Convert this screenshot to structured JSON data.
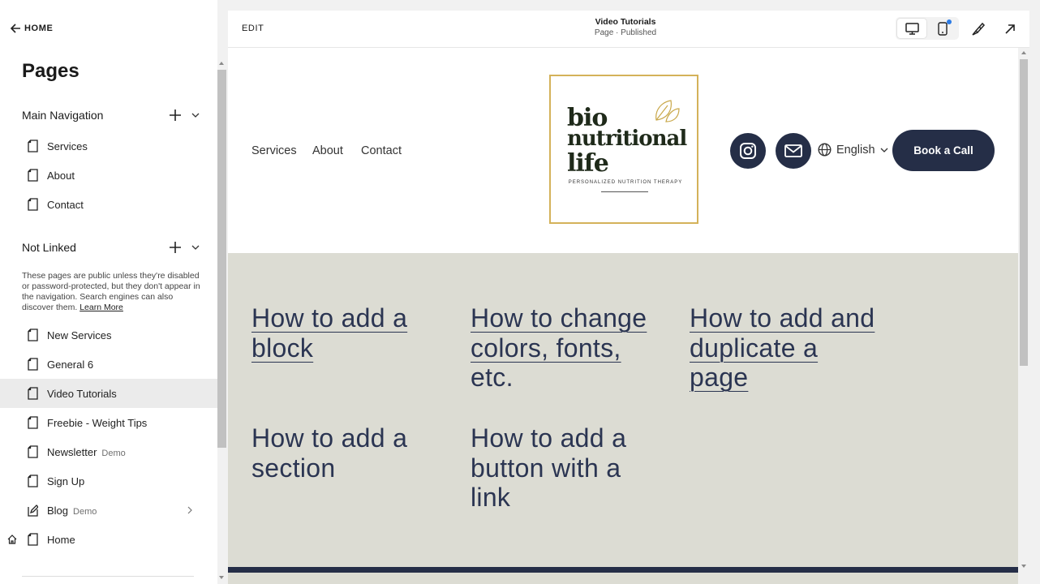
{
  "sidebar": {
    "back_label": "HOME",
    "title": "Pages",
    "main_navigation": {
      "label": "Main Navigation",
      "items": [
        {
          "label": "Services"
        },
        {
          "label": "About"
        },
        {
          "label": "Contact"
        }
      ]
    },
    "not_linked": {
      "label": "Not Linked",
      "note": "These pages are public unless they're disabled or password-protected, but they don't appear in the navigation. Search engines can also discover them.",
      "learn_more": "Learn More",
      "items": [
        {
          "label": "New Services",
          "badge": ""
        },
        {
          "label": "General 6",
          "badge": ""
        },
        {
          "label": "Video Tutorials",
          "badge": "",
          "selected": true
        },
        {
          "label": "Freebie - Weight Tips",
          "badge": ""
        },
        {
          "label": "Newsletter",
          "badge": "Demo"
        },
        {
          "label": "Sign Up",
          "badge": ""
        },
        {
          "label": "Blog",
          "badge": "Demo"
        },
        {
          "label": "Home",
          "badge": ""
        }
      ]
    }
  },
  "editor": {
    "edit_label": "EDIT",
    "page_title": "Video Tutorials",
    "page_status": "Page · Published",
    "icons": [
      "desktop-icon",
      "mobile-icon",
      "brush-icon",
      "external-arrow-icon"
    ]
  },
  "site": {
    "nav": [
      "Services",
      "About",
      "Contact"
    ],
    "logo": {
      "line1": "bio",
      "line2": "nutritional",
      "line3": "life",
      "tagline": "PERSONALIZED NUTRITION THERAPY"
    },
    "language": "English",
    "cta": "Book a Call",
    "tutorials": [
      {
        "lines": [
          "How to add a",
          "block"
        ],
        "link": true
      },
      {
        "lines": [
          "How to change",
          "colors, fonts,",
          "etc."
        ],
        "link": true
      },
      {
        "lines": [
          "How to add and",
          "duplicate a",
          "page"
        ],
        "link": true
      },
      {
        "lines": [
          "How to add a",
          "section"
        ],
        "link": false
      },
      {
        "lines": [
          "How to add a",
          "button with a",
          "link"
        ],
        "link": false
      }
    ]
  },
  "colors": {
    "navy": "#252e47",
    "text_navy": "#2b3552",
    "body_bg": "#dcdcd3",
    "gold": "#d4b25a",
    "selected_row": "#ebebeb"
  }
}
